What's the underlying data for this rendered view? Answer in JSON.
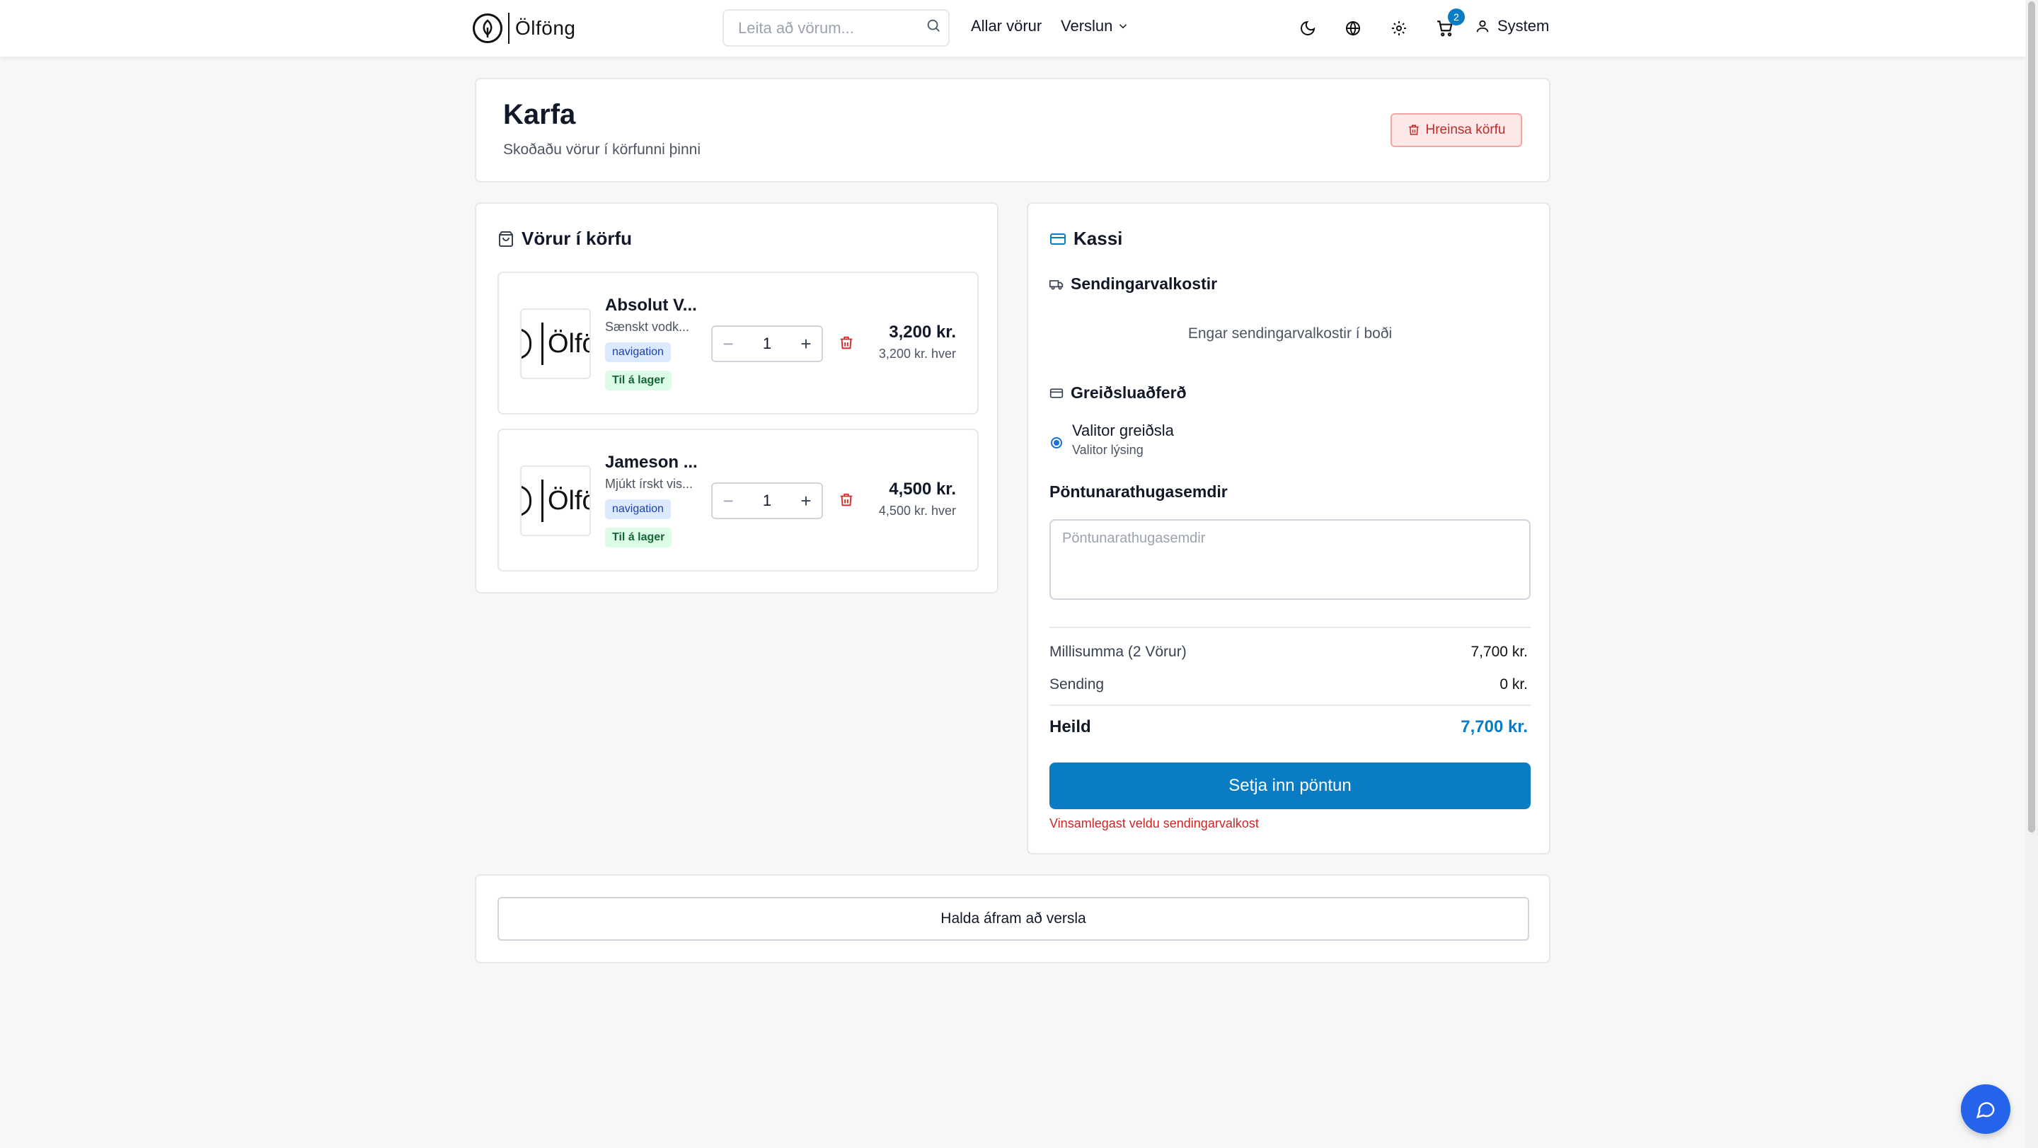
{
  "header": {
    "logo_text": "Ölföng",
    "search_placeholder": "Leita að vörum...",
    "nav_all_products": "Allar vörur",
    "nav_shop": "Verslun",
    "cart_count": "2",
    "user_name": "System"
  },
  "page": {
    "title": "Karfa",
    "subtitle": "Skoðaðu vörur í körfunni þinni",
    "clear_button": "Hreinsa körfu"
  },
  "cart": {
    "heading": "Vörur í körfu",
    "items": [
      {
        "name": "Absolut V...",
        "description": "Sænskt vodk...",
        "category_tag": "navigation",
        "stock_tag": "Til á lager",
        "quantity": "1",
        "price": "3,200 kr.",
        "unit_price": "3,200 kr. hver",
        "thumb_text": "Ölfö"
      },
      {
        "name": "Jameson ...",
        "description": "Mjúkt írskt vis...",
        "category_tag": "navigation",
        "stock_tag": "Til á lager",
        "quantity": "1",
        "price": "4,500 kr.",
        "unit_price": "4,500 kr. hver",
        "thumb_text": "Ölfö"
      }
    ]
  },
  "checkout": {
    "heading": "Kassi",
    "shipping_heading": "Sendingarvalkostir",
    "no_shipping": "Engar sendingarvalkostir í boði",
    "payment_heading": "Greiðsluaðferð",
    "payment_option_name": "Valitor greiðsla",
    "payment_option_desc": "Valitor lýsing",
    "notes_heading": "Pöntunarathugasemdir",
    "notes_placeholder": "Pöntunarathugasemdir",
    "subtotal_label": "Millisumma (2 Vörur)",
    "subtotal_value": "7,700 kr.",
    "shipping_label": "Sending",
    "shipping_value": "0 kr.",
    "total_label": "Heild",
    "total_value": "7,700 kr.",
    "place_order": "Setja inn pöntun",
    "warning": "Vinsamlegast veldu sendingarvalkost"
  },
  "footer": {
    "continue_shopping": "Halda áfram að versla"
  },
  "colors": {
    "accent": "#0a7cc4",
    "danger": "#c62828",
    "chat_button": "#2563eb"
  }
}
